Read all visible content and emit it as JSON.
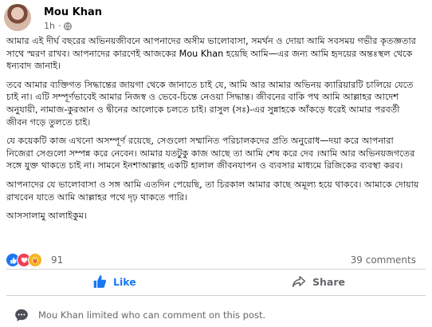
{
  "post": {
    "author": "Mou Khan",
    "time": "1h",
    "separator": "·",
    "paragraphs": [
      "আমার এই দীর্ঘ বছরের অভিনয়জীবনে আপনাদের অসীম ভালোবাসা, সমর্থন ও দোয়া আমি সবসময় গভীর কৃতজ্ঞতার সাথে স্মরণ রাখব। আপনাদের কারণেই আজকের Mou Khan হয়েছি আমি—এর জন্য আমি হৃদয়ের অন্তঃস্থল থেকে ধন্যবাদ জানাই।",
      "তবে আমার ব্যক্তিগত সিদ্ধান্তের জায়গা থেকে জানাতে চাই যে, আমি আর আমার অভিনয় ক্যারিয়ারটি চালিয়ে যেতে চাই না। এটি সম্পূর্ণভাবেই আমার নিজস্ব ও ভেবে-চিন্তে নেওয়া সিদ্ধান্ত। জীবনের বাকি পথ আমি আল্লাহর আদেশ অনুযায়ী, নামাজ-কুরআন ও দ্বীনের আলোকে চলতে চাই। রাসুল (সঃ)-এর সুন্নাহকে আঁকড়ে ধরেই আমার পরবর্তী জীবন গড়ে তুলতে চাই।",
      "যে কয়েকটি কাজ এখনো অসম্পূর্ণ রয়েছে, সেগুলো সম্মানিত পরিচালকদের প্রতি অনুরোধ—দয়া করে আপনারা নিজেরা সেগুলো সম্পন্ন করে নেবেন। আমার যতটুকু কাজ আছে তা আমি শেষ করে দেব ।আমি আর অভিনয়জগতের সঙ্গে যুক্ত থাকতে চাই না। সামনে ইনশাআল্লাহ একটি হালাল জীবনযাপন ও ব্যবসার মাধ্যমে রিজিকের ব্যবস্থা করব।",
      "আপনাদের যে ভালোবাসা ও সঙ্গ আমি এতদিন পেয়েছি, তা চিরকাল আমার কাছে অমূল্য হয়ে থাকবে। আমাকে দোয়ায় রাখবেন যাতে আমি আল্লাহর পথে দৃঢ় থাকতে পারি।",
      "আসসালামু আলাইকুম।"
    ]
  },
  "reactions": {
    "count": "91",
    "types": [
      "like",
      "love",
      "care"
    ],
    "comments": "39 comments"
  },
  "actions": {
    "like_label": "Like",
    "share_label": "Share"
  },
  "notice": {
    "text": "Mou Khan limited who can comment on this post."
  },
  "colors": {
    "accent": "#1877f2",
    "muted": "#65676b",
    "divider": "#ced0d4"
  }
}
